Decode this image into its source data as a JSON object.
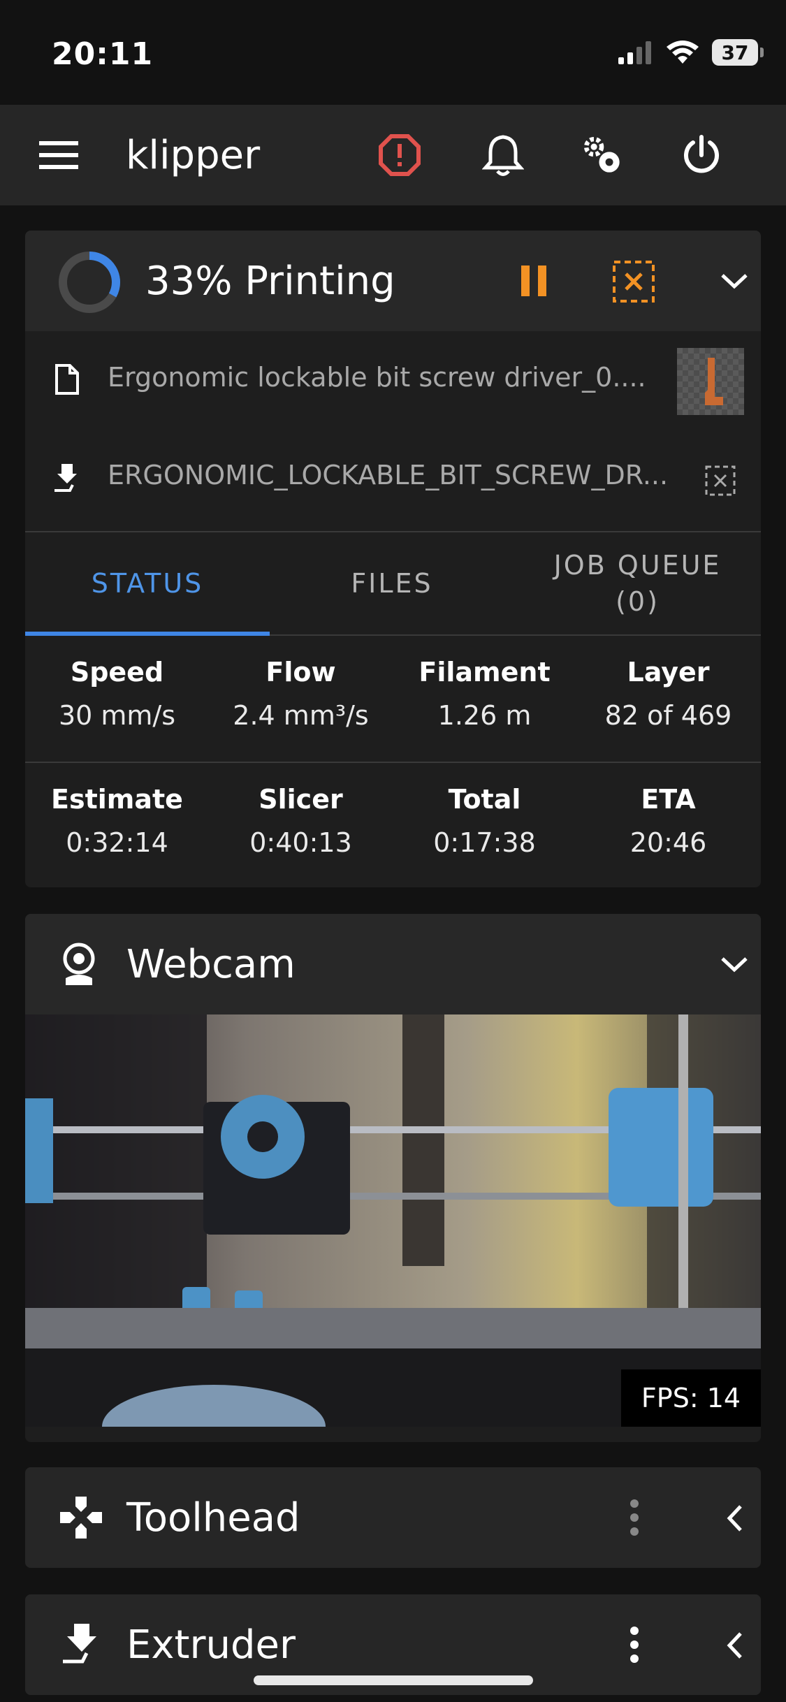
{
  "status_bar": {
    "time": "20:11",
    "battery": "37"
  },
  "appbar": {
    "title": "klipper",
    "icons": [
      "menu-icon",
      "alert-icon",
      "bell-icon",
      "settings-icon",
      "power-icon"
    ]
  },
  "job": {
    "progress_label": "33% Printing",
    "progress_percent": 33,
    "filename": "Ergonomic lockable bit screw driver_0....",
    "object": "ERGONOMIC_LOCKABLE_BIT_SCREW_DR...",
    "tabs": [
      {
        "label": "STATUS",
        "active": true
      },
      {
        "label": "FILES",
        "active": false
      },
      {
        "label": "JOB QUEUE\n(0)",
        "active": false
      }
    ],
    "stats_row1": [
      {
        "k": "Speed",
        "v": "30 mm/s"
      },
      {
        "k": "Flow",
        "v": "2.4 mm³/s"
      },
      {
        "k": "Filament",
        "v": "1.26 m"
      },
      {
        "k": "Layer",
        "v": "82 of 469"
      }
    ],
    "stats_row2": [
      {
        "k": "Estimate",
        "v": "0:32:14"
      },
      {
        "k": "Slicer",
        "v": "0:40:13"
      },
      {
        "k": "Total",
        "v": "0:17:38"
      },
      {
        "k": "ETA",
        "v": "20:46"
      }
    ]
  },
  "webcam": {
    "title": "Webcam",
    "fps": "FPS: 14"
  },
  "toolhead": {
    "title": "Toolhead"
  },
  "extruder": {
    "title": "Extruder"
  },
  "colors": {
    "accent": "#3f86e6",
    "warning": "#f39224",
    "error": "#e0524d",
    "background": "#121212",
    "card": "#1e1e1e"
  }
}
